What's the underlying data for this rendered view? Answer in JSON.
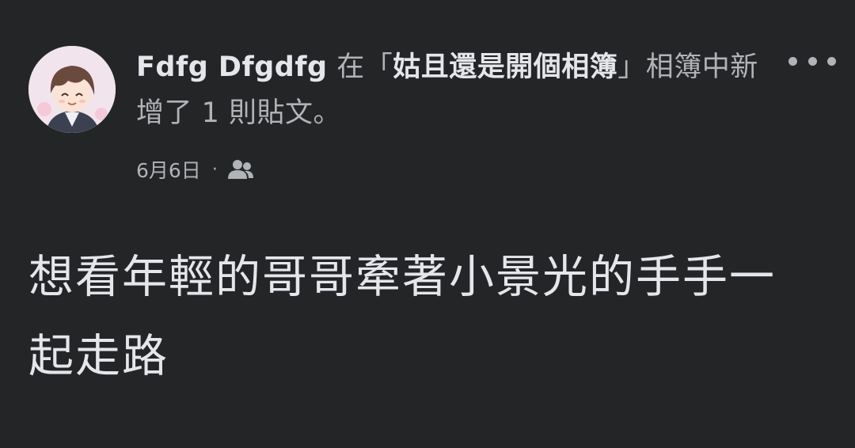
{
  "post": {
    "author": "Fdfg Dfgdfg",
    "action_prefix": " 在「",
    "album_name": "姑且還是開個相簿",
    "action_suffix": "」相簿中新增了 1 則貼文。",
    "timestamp": "6月6日",
    "separator": "·",
    "audience_icon": "friends-icon",
    "more_icon": "more-options-icon",
    "body": "想看年輕的哥哥牽著小景光的手手一起走路"
  },
  "colors": {
    "background": "#242526",
    "primary_text": "#e4e6eb",
    "secondary_text": "#b0b3b8"
  }
}
